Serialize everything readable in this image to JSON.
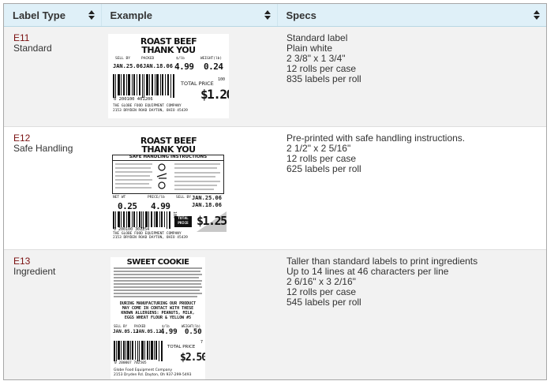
{
  "table": {
    "headers": [
      "Label Type",
      "Example",
      "Specs"
    ],
    "rows": [
      {
        "code": "E11",
        "type": "Standard",
        "specs": [
          "Standard label",
          "Plain white",
          "2 3/8\" x 1 3/4\"",
          "12 rolls per case",
          "835 labels per roll"
        ],
        "label": {
          "title1": "ROAST BEEF",
          "title2": "THANK YOU",
          "sell_by_hdr": "SELL BY",
          "packed_hdr": "PACKED",
          "price_lb_hdr": "$/lb",
          "weight_hdr": "WEIGHT(lb)",
          "sell_by": "JAN.25.06",
          "packed": "JAN.18.06",
          "price_lb": "4.99",
          "weight": "0.24",
          "total_label": "TOTAL PRICE",
          "total_sup": "100",
          "total": "$1.20",
          "barcode_num": "0 200100 401206",
          "company1": "THE GLOBE FOOD EQUIPMENT COMPANY",
          "company2": "2153 DRYDEN ROAD   DAYTON, OHIO  45439"
        }
      },
      {
        "code": "E12",
        "type": "Safe Handling",
        "specs": [
          "Pre-printed with safe handling instructions.",
          "2 1/2\" x 2 5/16\"",
          "12 rolls per case",
          "625 labels per roll"
        ],
        "label": {
          "title1": "ROAST BEEF",
          "title2": "THANK YOU",
          "safe_title": "SAFE HANDLING INSTRUCTIONS",
          "net_wt_hdr": "NET WT",
          "price_hdr": "PRICE/lb",
          "sell_by_hdr": "SELL BY",
          "net_wt": "0.25",
          "price": "4.99",
          "sell_by": "JAN.25.06",
          "packed": "JAN.18.06",
          "side_num": "100",
          "total_label1": "TOTAL",
          "total_label2": "PRICE",
          "total": "$1.25",
          "barcode_num": "0 200100 301254",
          "company1": "THE GLOBE FOOD EQUIPMENT COMPANY",
          "company2": "2153 DRYDEN ROAD   DAYTON, OHIO  45439"
        }
      },
      {
        "code": "E13",
        "type": "Ingredient",
        "specs": [
          "Taller than standard labels to print ingredients",
          "Up to 14 lines at 46 characters per line",
          "2 6/16\" x 3 2/16\"",
          "12 rolls per case",
          "545 labels per roll"
        ],
        "label": {
          "title": "SWEET COOKIE",
          "allergen1": "DURING MANUFACTURING OUR PRODUCT",
          "allergen2": "MAY COME IN CONTACT WITH THESE",
          "allergen3": "KNOWN ALLERGENS: PEANUTS, MILK,",
          "allergen4": "EGGS WHEAT FLOUR & YELLOW #5",
          "sell_by_hdr": "SELL BY",
          "packed_hdr": "PACKED",
          "price_lb_hdr": "$/lb",
          "weight_hdr": "WEIGHT(lb)",
          "sell_by": "JAN.05.12",
          "packed": "JAN.05.12",
          "price_lb": "4.99",
          "weight": "0.50",
          "total_label": "TOTAL PRICE",
          "total_sup": "7",
          "total": "$2.50",
          "barcode_num": "0 200007 702505",
          "company1": "Globe Food Equipment Company",
          "company2": "2153 Dryden Rd.  Dayton, Oh  937-299-5493"
        }
      }
    ]
  }
}
